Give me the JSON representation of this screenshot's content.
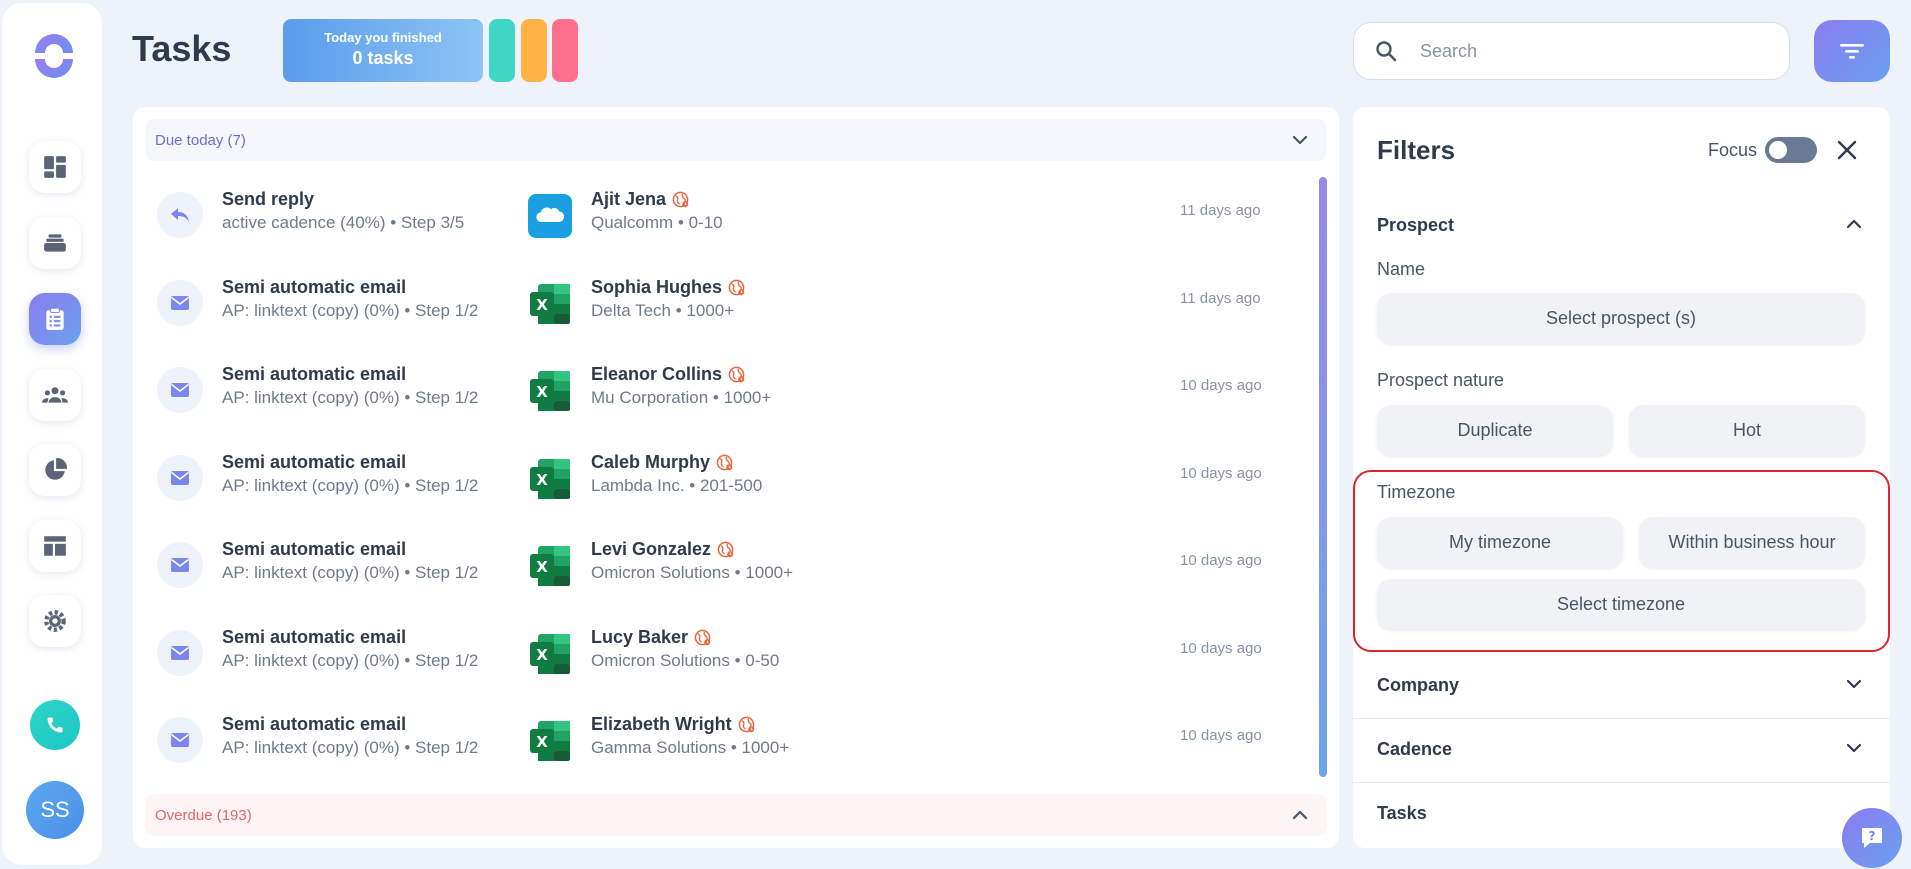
{
  "header": {
    "title": "Tasks",
    "finished_line1": "Today you finished",
    "finished_line2": "0 tasks",
    "swatch_colors": [
      "#3fd6c4",
      "#ffb347",
      "#ff6f8e"
    ]
  },
  "search": {
    "placeholder": "Search",
    "value": ""
  },
  "sidebar": {
    "items": [
      "dashboard-icon",
      "inbox-stack-icon",
      "tasks-clipboard-icon",
      "people-icon",
      "pie-chart-icon",
      "layout-icon",
      "gear-icon"
    ],
    "active": "tasks-clipboard-icon",
    "avatar_initials": "SS"
  },
  "main": {
    "due_label": "Due today (7)",
    "overdue_label": "Overdue (193)",
    "rows": [
      {
        "type": "reply",
        "title": "Send reply",
        "sub": "active cadence (40%) • Step 3/5",
        "crm": "salesforce",
        "name": "Ajit Jena",
        "company": "Qualcomm • 0-10",
        "time": "11 days ago"
      },
      {
        "type": "email",
        "title": "Semi automatic email",
        "sub": "AP: linktext (copy) (0%) • Step 1/2",
        "crm": "excel",
        "name": "Sophia Hughes",
        "company": "Delta Tech • 1000+",
        "time": "11 days ago"
      },
      {
        "type": "email",
        "title": "Semi automatic email",
        "sub": "AP: linktext (copy) (0%) • Step 1/2",
        "crm": "excel",
        "name": "Eleanor Collins",
        "company": "Mu Corporation • 1000+",
        "time": "10 days ago"
      },
      {
        "type": "email",
        "title": "Semi automatic email",
        "sub": "AP: linktext (copy) (0%) • Step 1/2",
        "crm": "excel",
        "name": "Caleb Murphy",
        "company": "Lambda Inc. • 201-500",
        "time": "10 days ago"
      },
      {
        "type": "email",
        "title": "Semi automatic email",
        "sub": "AP: linktext (copy) (0%) • Step 1/2",
        "crm": "excel",
        "name": "Levi Gonzalez",
        "company": "Omicron Solutions • 1000+",
        "time": "10 days ago"
      },
      {
        "type": "email",
        "title": "Semi automatic email",
        "sub": "AP: linktext (copy) (0%) • Step 1/2",
        "crm": "excel",
        "name": "Lucy Baker",
        "company": "Omicron Solutions • 0-50",
        "time": "10 days ago"
      },
      {
        "type": "email",
        "title": "Semi automatic email",
        "sub": "AP: linktext (copy) (0%) • Step 1/2",
        "crm": "excel",
        "name": "Elizabeth Wright",
        "company": "Gamma Solutions • 1000+",
        "time": "10 days ago"
      }
    ]
  },
  "filters": {
    "title": "Filters",
    "focus_label": "Focus",
    "focus_on": false,
    "prospect_label": "Prospect",
    "name_label": "Name",
    "select_prospect": "Select prospect (s)",
    "nature_label": "Prospect nature",
    "duplicate": "Duplicate",
    "hot": "Hot",
    "timezone_label": "Timezone",
    "my_timezone": "My timezone",
    "business_hour": "Within business hour",
    "select_timezone": "Select timezone",
    "company_label": "Company",
    "cadence_label": "Cadence",
    "tasks_label": "Tasks"
  }
}
